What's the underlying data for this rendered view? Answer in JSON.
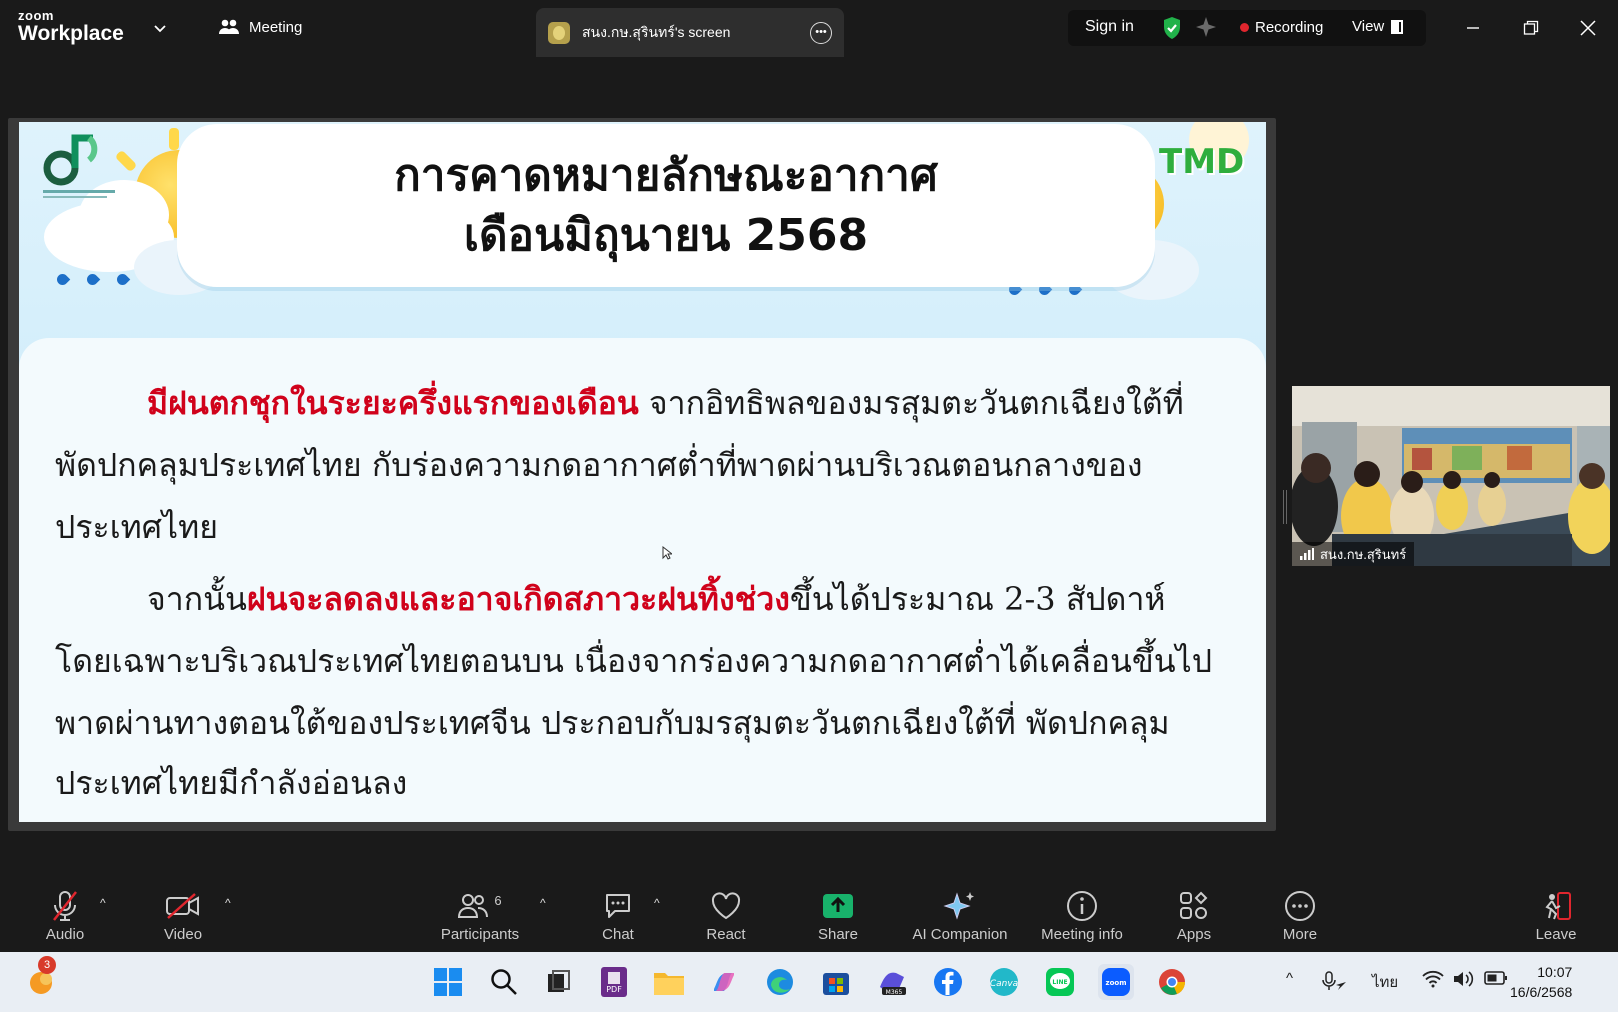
{
  "titlebar": {
    "brand_small": "zoom",
    "brand_large": "Workplace",
    "meeting_label": "Meeting",
    "share_tab_title": "สนง.กษ.สุรินทร์'s screen",
    "sign_in": "Sign in",
    "recording": "Recording",
    "view": "View"
  },
  "slide": {
    "title_line1": "การคาดหมายลักษณะอากาศ",
    "title_line2": "เดือนมิถุนายน 2568",
    "logo_right": "TMD",
    "p1_red": "มีฝนตกชุกในระยะครึ่งแรกของเดือน",
    "p1_rest": " จากอิทธิพลของมรสุมตะวันตกเฉียงใต้ที่",
    "p1_line2": "พัดปกคลุมประเทศไทย กับร่องความกดอากาศต่ำที่พาดผ่านบริเวณตอนกลางของ",
    "p1_line3": "ประเทศไทย",
    "p2_start": "จากนั้น",
    "p2_red": "ฝนจะลดลงและอาจเกิดสภาวะฝนทิ้งช่วง",
    "p2_rest": "ขึ้นได้ประมาณ 2-3 สัปดาห์",
    "p2_line2": "โดยเฉพาะบริเวณประเทศไทยตอนบน เนื่องจากร่องความกดอากาศต่ำได้เคลื่อนขึ้นไป",
    "p2_line3": "พาดผ่านทางตอนใต้ของประเทศจีน ประกอบกับมรสุมตะวันตกเฉียงใต้ที่ พัดปกคลุม",
    "p2_line4": "ประเทศไทยมีกำลังอ่อนลง"
  },
  "video": {
    "participant_name": "สนง.กษ.สุรินทร์"
  },
  "toolbar": {
    "audio": "Audio",
    "video": "Video",
    "participants": "Participants",
    "participant_count": "6",
    "chat": "Chat",
    "react": "React",
    "share": "Share",
    "ai_companion": "AI Companion",
    "meeting_info": "Meeting info",
    "apps": "Apps",
    "more": "More",
    "leave": "Leave"
  },
  "taskbar": {
    "notification_count": "3",
    "language": "ไทย",
    "time": "10:07",
    "date": "16/6/2568",
    "apps": [
      "windows-start",
      "search",
      "task-view",
      "pdf",
      "file-explorer",
      "copilot",
      "edge",
      "store",
      "m365",
      "facebook",
      "canva",
      "line",
      "zoom",
      "chrome"
    ]
  },
  "colors": {
    "accent_red": "#d0021b",
    "share_green": "#18b26b",
    "recording_red": "#e0262e"
  }
}
